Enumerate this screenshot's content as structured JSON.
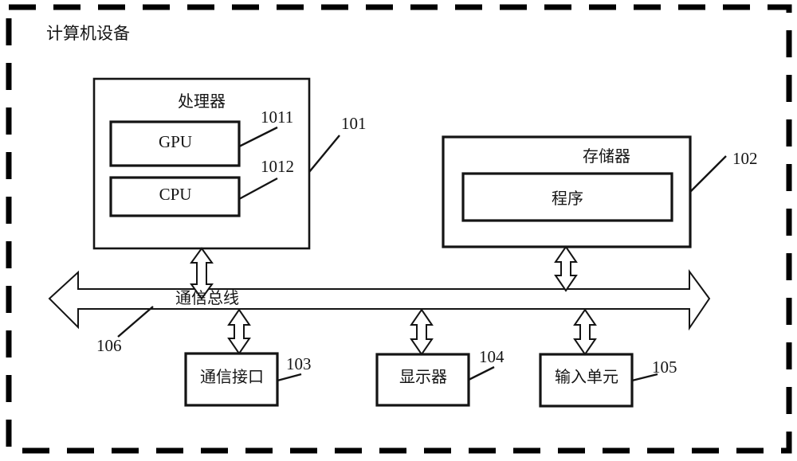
{
  "figure": {
    "kind": "patent-block-diagram",
    "outer_container": {
      "label": "计算机设备",
      "border_style": "dashed",
      "color": "#000000"
    },
    "colors": {
      "line": "#141414",
      "text": "#141414",
      "background": "#ffffff"
    },
    "blocks": {
      "processor": {
        "label": "处理器",
        "ref": "101",
        "children": [
          {
            "label": "GPU",
            "ref": "1011"
          },
          {
            "label": "CPU",
            "ref": "1012"
          }
        ]
      },
      "memory": {
        "label": "存储器",
        "ref": "102",
        "children": [
          {
            "label": "程序",
            "ref": ""
          }
        ]
      },
      "bus": {
        "label": "通信总线",
        "ref": "106"
      },
      "comm_interface": {
        "label": "通信接口",
        "ref": "103"
      },
      "display": {
        "label": "显示器",
        "ref": "104"
      },
      "input_unit": {
        "label": "输入单元",
        "ref": "105"
      }
    },
    "connections": [
      {
        "from": "processor",
        "to": "bus",
        "style": "double-headed-arrow"
      },
      {
        "from": "memory",
        "to": "bus",
        "style": "double-headed-arrow"
      },
      {
        "from": "bus",
        "to": "comm_interface",
        "style": "double-headed-arrow"
      },
      {
        "from": "bus",
        "to": "display",
        "style": "double-headed-arrow"
      },
      {
        "from": "bus",
        "to": "input_unit",
        "style": "double-headed-arrow"
      }
    ]
  }
}
